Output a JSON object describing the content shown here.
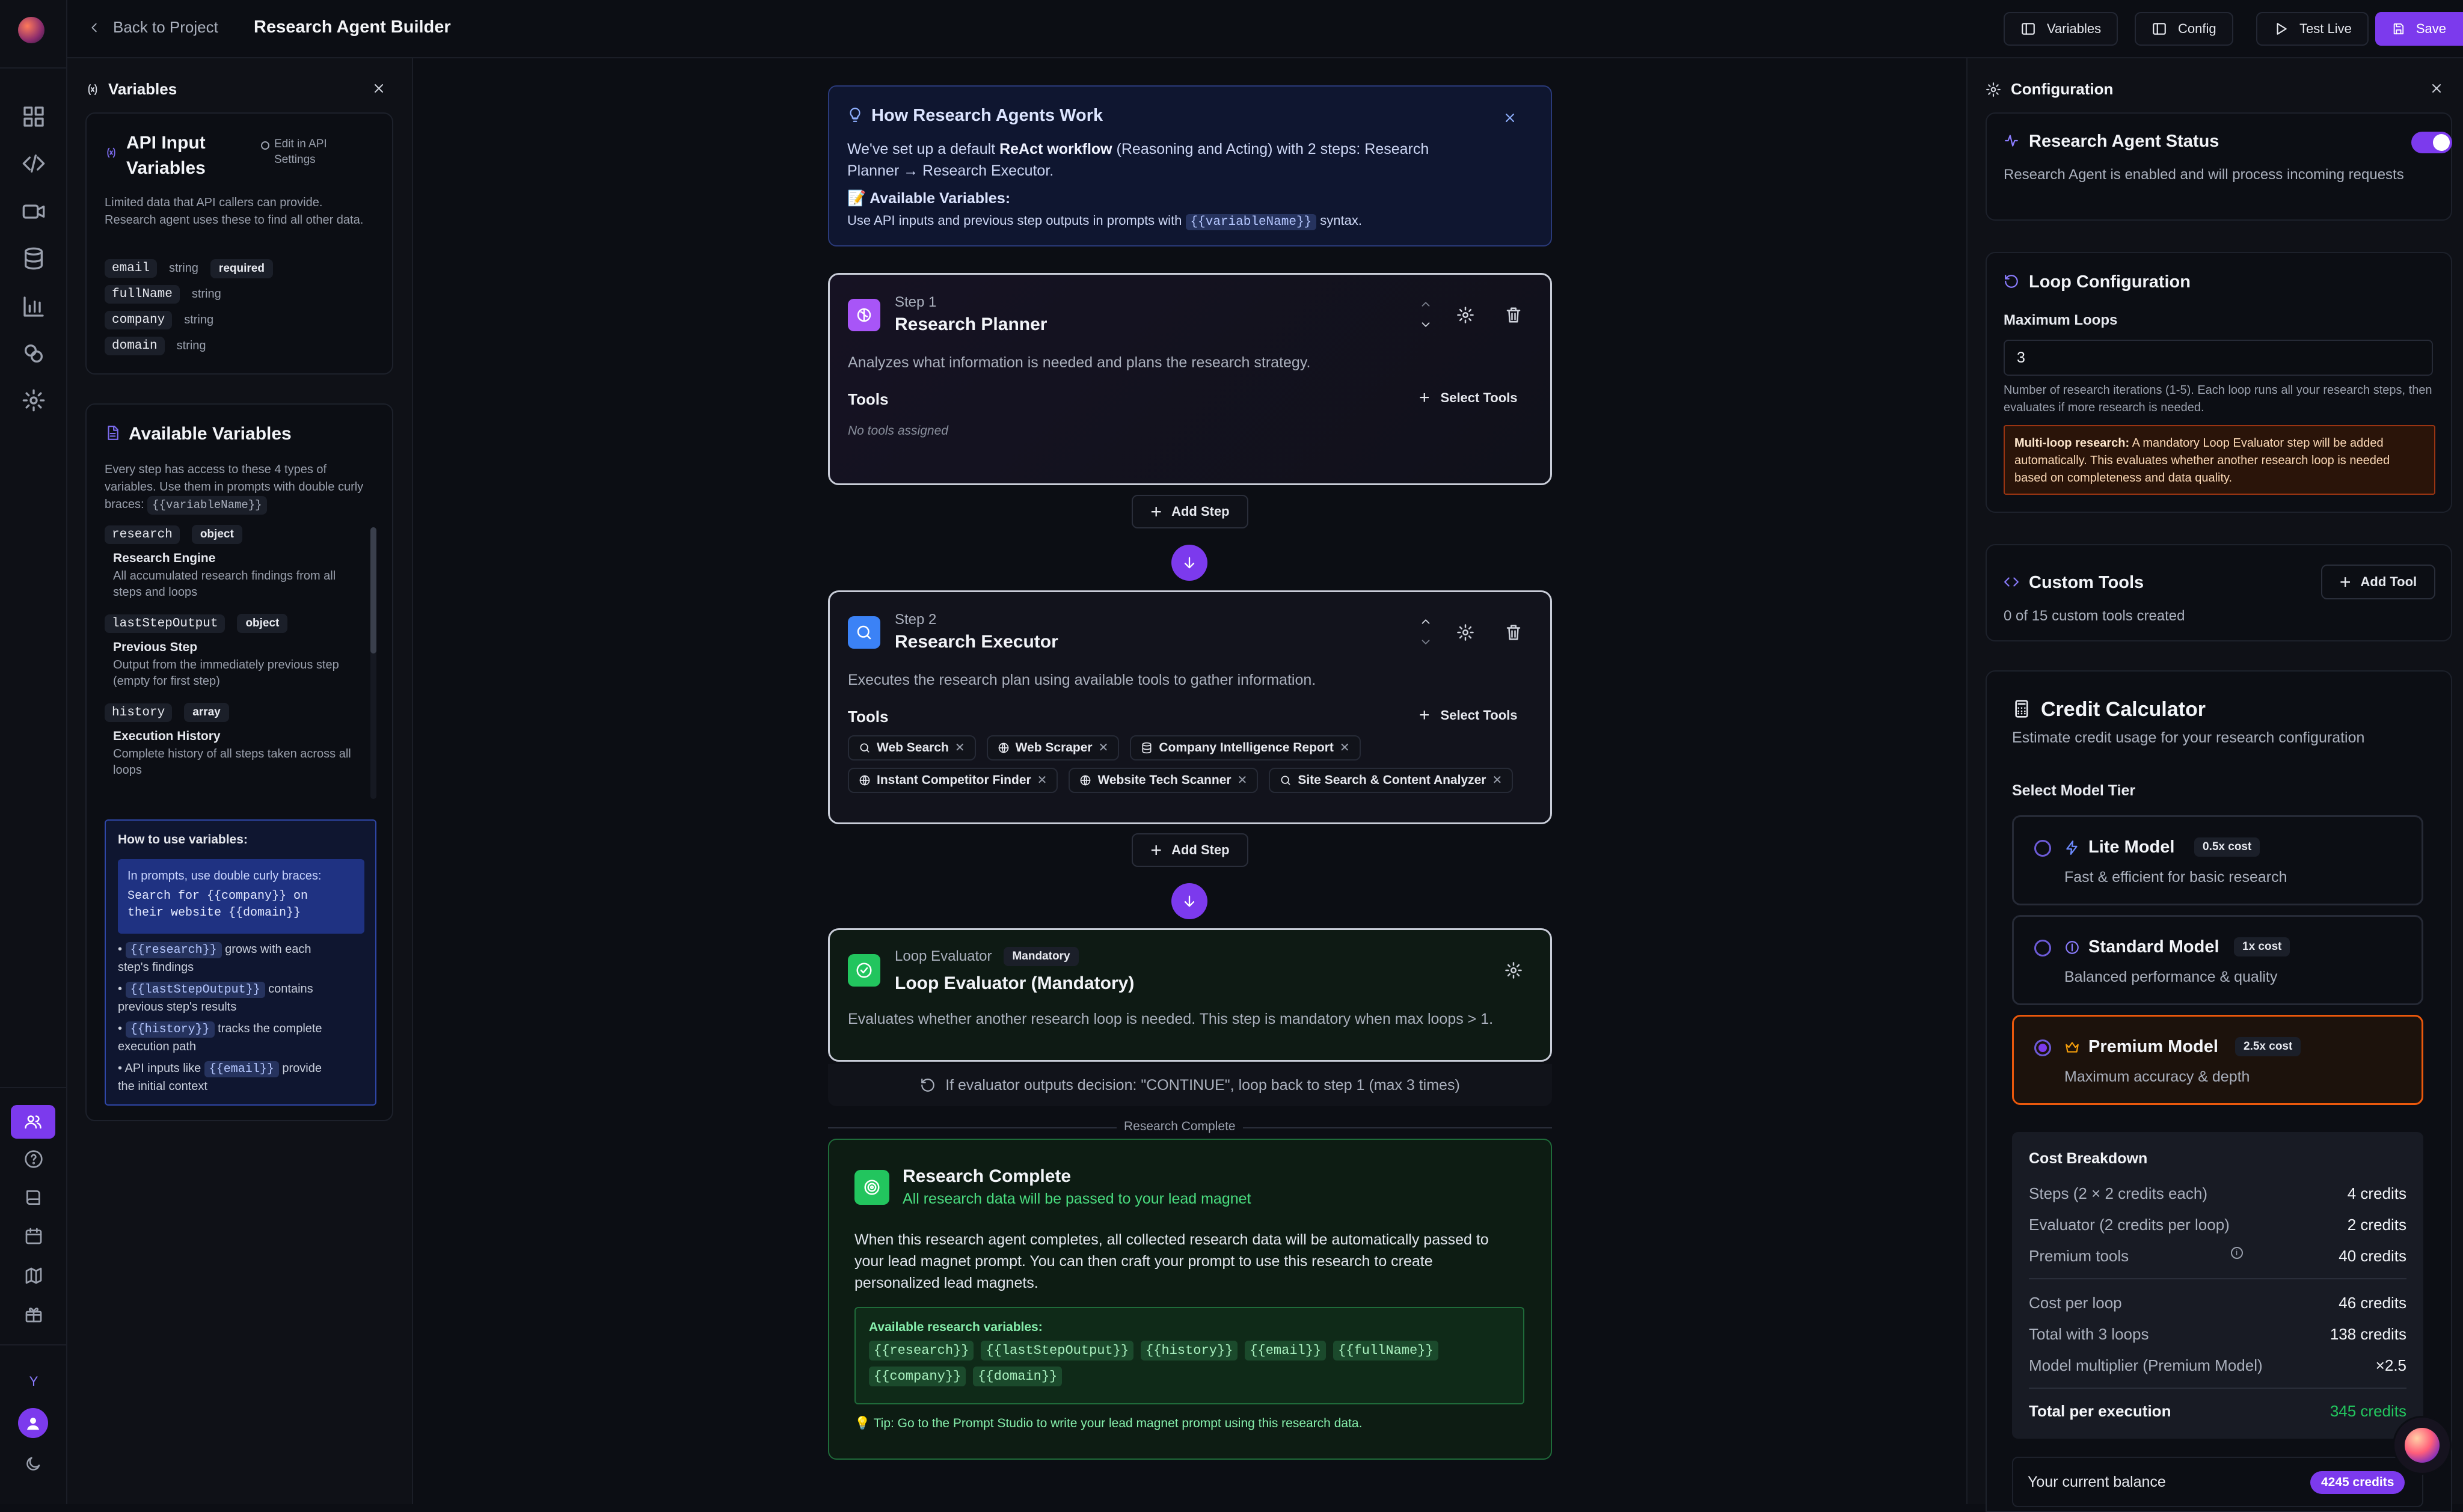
{
  "header": {
    "back_label": "Back to Project",
    "title": "Research Agent Builder",
    "variables_btn": "Variables",
    "config_btn": "Config",
    "test_btn": "Test Live",
    "save_btn": "Save"
  },
  "rail": {
    "user_initial": "Y"
  },
  "variables_panel": {
    "title": "Variables",
    "api_card": {
      "title_line1": "API Input",
      "title_line2": "Variables",
      "edit_line1": "Edit in API",
      "edit_line2": "Settings",
      "desc": "Limited data that API callers can provide. Research agent uses these to find all other data.",
      "vars": [
        {
          "name": "email",
          "type": "string",
          "badge": "required"
        },
        {
          "name": "fullName",
          "type": "string",
          "badge": ""
        },
        {
          "name": "company",
          "type": "string",
          "badge": ""
        },
        {
          "name": "domain",
          "type": "string",
          "badge": ""
        }
      ]
    },
    "avail_card": {
      "title": "Available Variables",
      "desc": "Every step has access to these 4 types of variables. Use them in prompts with double curly braces:",
      "desc_code": "{{variableName}}",
      "items": [
        {
          "name": "research",
          "type": "object",
          "label": "Research Engine",
          "desc": "All accumulated research findings from all steps and loops"
        },
        {
          "name": "lastStepOutput",
          "type": "object",
          "label": "Previous Step",
          "desc": "Output from the immediately previous step (empty for first step)"
        },
        {
          "name": "history",
          "type": "array",
          "label": "Execution History",
          "desc": "Complete history of all steps taken across all loops"
        }
      ],
      "howto": {
        "title": "How to use variables:",
        "example_intro": "In prompts, use double curly braces:",
        "example_code_1": "Search for {{company}} on",
        "example_code_2": "their website {{domain}}",
        "bullets": [
          {
            "code": "{{research}}",
            "text_a": " grows with each",
            "text_b": "step's findings"
          },
          {
            "code": "{{lastStepOutput}}",
            "text_a": " contains",
            "text_b": "previous step's results"
          },
          {
            "code": "{{history}}",
            "text_a": " tracks the complete",
            "text_b": "execution path"
          },
          {
            "pre": "API inputs like ",
            "code": "{{email}}",
            "text_a": " provide",
            "text_b": "the initial context"
          }
        ]
      }
    }
  },
  "info_box": {
    "title": "How Research Agents Work",
    "line1_a": "We've set up a default ",
    "line1_b": "ReAct workflow",
    "line1_c": " (Reasoning and Acting) with 2 steps: Research",
    "line2": "Planner → Research Executor.",
    "vars_title": "📝 Available Variables:",
    "vars_text_a": "Use API inputs and previous step outputs in prompts with ",
    "vars_code": "{{variableName}}",
    "vars_text_b": " syntax."
  },
  "steps": [
    {
      "num": "Step 1",
      "name": "Research Planner",
      "desc": "Analyzes what information is needed and plans the research strategy.",
      "tools_label": "Tools",
      "select_tools": "Select Tools",
      "empty": "No tools assigned"
    },
    {
      "num": "Step 2",
      "name": "Research Executor",
      "desc": "Executes the research plan using available tools to gather information.",
      "tools_label": "Tools",
      "select_tools": "Select Tools",
      "tools": [
        {
          "icon": "search-icon",
          "label": "Web Search"
        },
        {
          "icon": "globe-icon",
          "label": "Web Scraper"
        },
        {
          "icon": "database-icon",
          "label": "Company Intelligence Report"
        },
        {
          "icon": "globe-icon",
          "label": "Instant Competitor Finder"
        },
        {
          "icon": "globe-icon",
          "label": "Website Tech Scanner"
        },
        {
          "icon": "search-icon",
          "label": "Site Search & Content Analyzer"
        }
      ]
    }
  ],
  "add_step": "Add Step",
  "evaluator": {
    "kind": "Loop Evaluator",
    "badge": "Mandatory",
    "name": "Loop Evaluator (Mandatory)",
    "desc": "Evaluates whether another research loop is needed. This step is mandatory when max loops > 1.",
    "loop_note": "If evaluator outputs decision: \"CONTINUE\", loop back to step 1 (max 3 times)",
    "divider": "Research Complete"
  },
  "complete": {
    "title": "Research Complete",
    "subtitle": "All research data will be passed to your lead magnet",
    "body": "When this research agent completes, all collected research data will be automatically passed to your lead magnet prompt. You can then craft your prompt to use this research to create personalized lead magnets.",
    "vars_title": "Available research variables:",
    "vars": [
      "{{research}}",
      "{{lastStepOutput}}",
      "{{history}}",
      "{{email}}",
      "{{fullName}}",
      "{{company}}",
      "{{domain}}"
    ],
    "tip": "💡 Tip: Go to the Prompt Studio to write your lead magnet prompt using this research data."
  },
  "config_panel": {
    "title": "Configuration",
    "status": {
      "title": "Research Agent Status",
      "desc": "Research Agent is enabled and will process incoming requests",
      "enabled": true
    },
    "loop": {
      "title": "Loop Configuration",
      "label": "Maximum Loops",
      "value": "3",
      "help": "Number of research iterations (1-5). Each loop runs all your research steps, then evaluates if more research is needed.",
      "warn_bold": "Multi-loop research:",
      "warn_text": " A mandatory Loop Evaluator step will be added automatically. This evaluates whether another research loop is needed based on completeness and data quality."
    },
    "custom_tools": {
      "title": "Custom Tools",
      "add_btn": "Add Tool",
      "count_text": "0 of 15 custom tools created"
    },
    "credit": {
      "title": "Credit Calculator",
      "subtitle": "Estimate credit usage for your research configuration",
      "tier_label": "Select Model Tier",
      "models": [
        {
          "name": "Lite Model",
          "cost": "0.5x cost",
          "desc": "Fast & efficient for basic research",
          "selected": false
        },
        {
          "name": "Standard Model",
          "cost": "1x cost",
          "desc": "Balanced performance & quality",
          "selected": false
        },
        {
          "name": "Premium Model",
          "cost": "2.5x cost",
          "desc": "Maximum accuracy & depth",
          "selected": true
        }
      ],
      "breakdown_title": "Cost Breakdown",
      "rows_a": [
        {
          "label": "Steps (2 × 2 credits each)",
          "value": "4 credits"
        },
        {
          "label": "Evaluator (2 credits per loop)",
          "value": "2 credits"
        },
        {
          "label": "Premium tools",
          "value": "40 credits"
        }
      ],
      "rows_b": [
        {
          "label": "Cost per loop",
          "value": "46 credits"
        },
        {
          "label": "Total with 3 loops",
          "value": "138 credits"
        },
        {
          "label": "Model multiplier (Premium Model)",
          "value": "×2.5"
        }
      ],
      "total_label": "Total per execution",
      "total_value": "345 credits",
      "balance_label": "Your current balance",
      "balance_value": "4245 credits"
    }
  },
  "colors": {
    "accent": "#7c3aed",
    "success": "#22c55e",
    "warning_border": "#b45309",
    "bg": "#0c0e14"
  }
}
